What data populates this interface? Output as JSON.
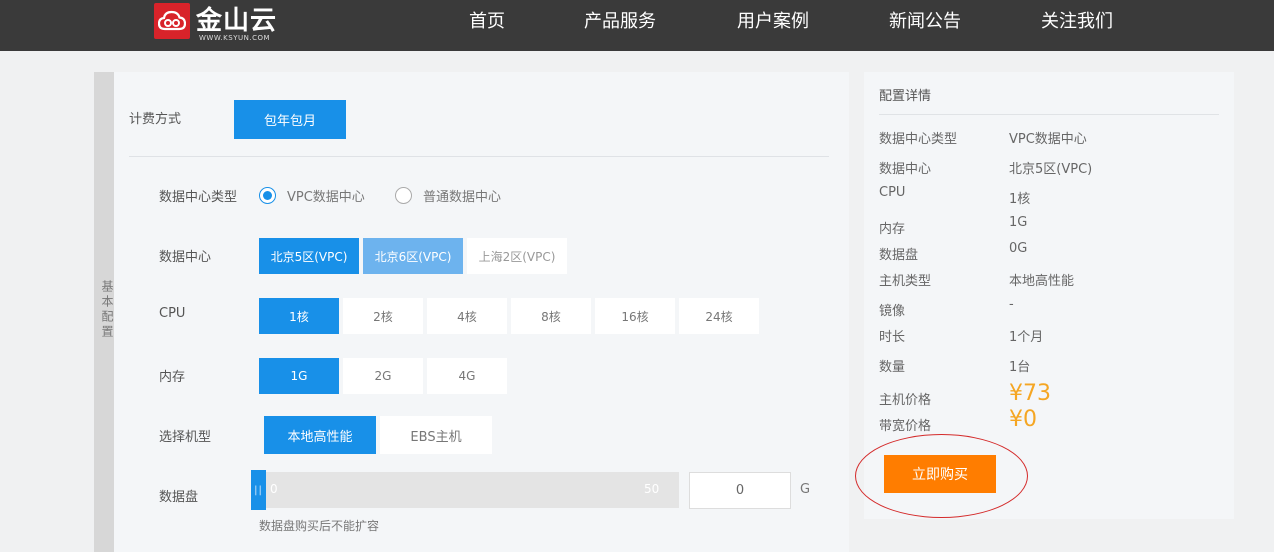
{
  "header": {
    "logo_text": "金山云",
    "logo_sub": "WWW.KSYUN.COM",
    "nav": [
      "首页",
      "产品服务",
      "用户案例",
      "新闻公告",
      "关注我们"
    ]
  },
  "sidetab": {
    "label": "基本配置"
  },
  "config": {
    "billing": {
      "label": "计费方式",
      "option": "包年包月"
    },
    "dc_type": {
      "label": "数据中心类型",
      "options": [
        "VPC数据中心",
        "普通数据中心"
      ],
      "selected": 0
    },
    "dc": {
      "label": "数据中心",
      "options": [
        "北京5区(VPC)",
        "北京6区(VPC)",
        "上海2区(VPC)"
      ]
    },
    "cpu": {
      "label": "CPU",
      "options": [
        "1核",
        "2核",
        "4核",
        "8核",
        "16核",
        "24核"
      ]
    },
    "memory": {
      "label": "内存",
      "options": [
        "1G",
        "2G",
        "4G"
      ]
    },
    "machine": {
      "label": "选择机型",
      "options": [
        "本地高性能",
        "EBS主机"
      ]
    },
    "disk": {
      "label": "数据盘",
      "handle": "||",
      "min": "0",
      "max": "50",
      "value": "0",
      "unit": "G",
      "note": "数据盘购买后不能扩容"
    }
  },
  "summary": {
    "title": "配置详情",
    "rows": [
      {
        "k": "数据中心类型",
        "v": "VPC数据中心"
      },
      {
        "k": "数据中心",
        "v": "北京5区(VPC)"
      },
      {
        "k": "CPU",
        "v": "1核"
      },
      {
        "k": "内存",
        "v": "1G"
      },
      {
        "k": "数据盘",
        "v": "0G"
      },
      {
        "k": "主机类型",
        "v": "本地高性能"
      },
      {
        "k": "镜像",
        "v": "-"
      },
      {
        "k": "时长",
        "v": "1个月"
      },
      {
        "k": "数量",
        "v": "1台"
      }
    ],
    "host_price_label": "主机价格",
    "host_price": "¥73",
    "bw_price_label": "带宽价格",
    "bw_price": "¥0",
    "buy_label": "立即购买"
  },
  "colors": {
    "primary": "#1890e8",
    "buy": "#ff7d00",
    "price": "#f5a623",
    "topbar": "#3a3a3a"
  }
}
